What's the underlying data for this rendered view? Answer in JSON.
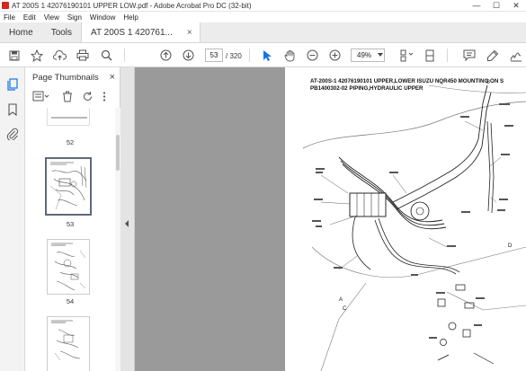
{
  "window": {
    "title": "AT 200S 1 42076190101 UPPER LOW.pdf - Adobe Acrobat Pro DC (32-bit)",
    "minimize": "—",
    "maximize": "☐",
    "close": "✕"
  },
  "menu": [
    "File",
    "Edit",
    "View",
    "Sign",
    "Window",
    "Help"
  ],
  "tabs": {
    "home": "Home",
    "tools": "Tools",
    "document": "AT 200S 1 420761...",
    "close": "×"
  },
  "toolbar": {
    "current_page": "53",
    "total_pages": "/ 320",
    "zoom": "49%"
  },
  "panel": {
    "title": "Page Thumbnails",
    "close": "×",
    "thumbnails": [
      {
        "label": "52",
        "selected": false
      },
      {
        "label": "53",
        "selected": true
      },
      {
        "label": "54",
        "selected": false
      },
      {
        "label": "",
        "selected": false
      }
    ]
  },
  "document": {
    "title_line1": "AT-200S-1 42076190101 UPPER,LOWER ISUZU NQR450 MOUNTING ON S",
    "title_line2": "PB1400302-02 PIPING,HYDRAULIC UPPER",
    "diagram_labels": {
      "callout_a": "A",
      "callout_b": "B",
      "callout_c": "C",
      "callout_d": "D"
    }
  },
  "colors": {
    "accent": "#1473e6",
    "doc_bg": "#9a9a9a",
    "tab_bg": "#ececec"
  }
}
